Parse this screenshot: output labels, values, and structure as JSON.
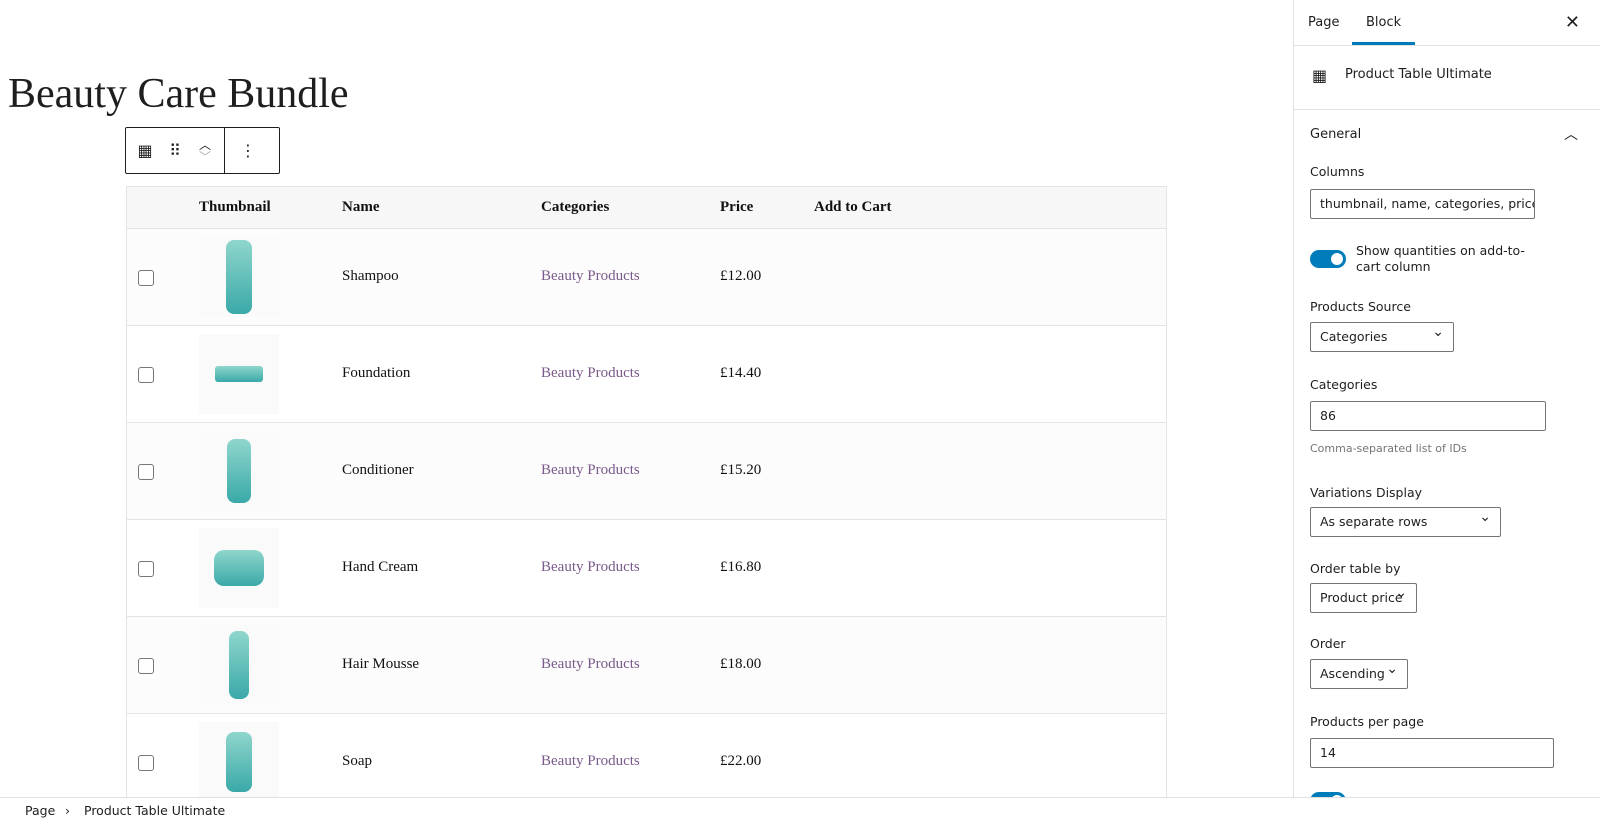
{
  "page": {
    "title": "Beauty Care Bundle"
  },
  "block_toolbar": {
    "icons": [
      "table-icon",
      "drag-handle-icon",
      "move-up-icon",
      "move-down-icon",
      "more-options-icon"
    ]
  },
  "table": {
    "headers": [
      "Thumbnail",
      "Name",
      "Categories",
      "Price",
      "Add to Cart"
    ],
    "rows": [
      {
        "name": "Shampoo",
        "category": "Beauty Products",
        "price": "£12.00"
      },
      {
        "name": "Foundation",
        "category": "Beauty Products",
        "price": "£14.40"
      },
      {
        "name": "Conditioner",
        "category": "Beauty Products",
        "price": "£15.20"
      },
      {
        "name": "Hand Cream",
        "category": "Beauty Products",
        "price": "£16.80"
      },
      {
        "name": "Hair Mousse",
        "category": "Beauty Products",
        "price": "£18.00"
      },
      {
        "name": "Soap",
        "category": "Beauty Products",
        "price": "£22.00"
      }
    ],
    "category_color": "#7a5a8a"
  },
  "sidebar": {
    "tabs": [
      "Page",
      "Block"
    ],
    "active_tab": "Block",
    "block_name": "Product Table Ultimate",
    "panel": "General",
    "columns_label": "Columns",
    "columns_value": "thumbnail, name, categories, price, add-to-cart",
    "show_qty_label": "Show quantities on add-to-cart column",
    "show_qty_on": true,
    "source_label": "Products Source",
    "source_value": "Categories",
    "categories_label": "Categories",
    "categories_value": "86",
    "categories_help": "Comma-separated list of IDs",
    "variations_label": "Variations Display",
    "variations_value": "As separate rows",
    "orderby_label": "Order table by",
    "orderby_value": "Product price",
    "order_label": "Order",
    "order_value": "Ascending",
    "perpage_label": "Products per page",
    "perpage_value": "14",
    "accent": "#007cba"
  },
  "breadcrumb": [
    "Page",
    "Product Table Ultimate"
  ]
}
